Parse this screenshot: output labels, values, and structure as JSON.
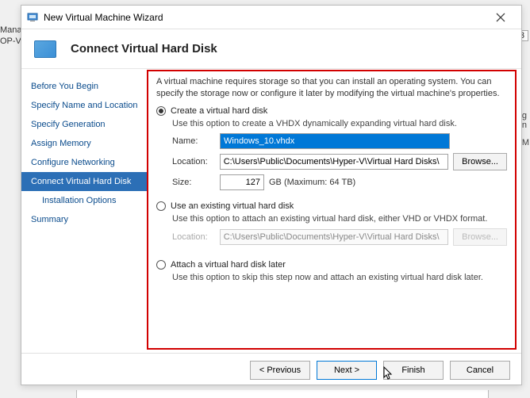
{
  "background": {
    "text1": "Manag",
    "text2": "OP-V",
    "text3": "3",
    "rlabel1": "g",
    "rlabel2": "n",
    "rlabel3": "M"
  },
  "titlebar": {
    "title": "New Virtual Machine Wizard"
  },
  "header": {
    "title": "Connect Virtual Hard Disk"
  },
  "sidebar": {
    "items": [
      {
        "label": "Before You Begin"
      },
      {
        "label": "Specify Name and Location"
      },
      {
        "label": "Specify Generation"
      },
      {
        "label": "Assign Memory"
      },
      {
        "label": "Configure Networking"
      },
      {
        "label": "Connect Virtual Hard Disk"
      },
      {
        "label": "Installation Options"
      },
      {
        "label": "Summary"
      }
    ]
  },
  "content": {
    "intro": "A virtual machine requires storage so that you can install an operating system. You can specify the storage now or configure it later by modifying the virtual machine's properties.",
    "opt1": {
      "label": "Create a virtual hard disk",
      "desc": "Use this option to create a VHDX dynamically expanding virtual hard disk.",
      "name_label": "Name:",
      "name_value": "Windows_10.vhdx",
      "loc_label": "Location:",
      "loc_value": "C:\\Users\\Public\\Documents\\Hyper-V\\Virtual Hard Disks\\",
      "browse": "Browse...",
      "size_label": "Size:",
      "size_value": "127",
      "size_unit": "GB (Maximum: 64 TB)"
    },
    "opt2": {
      "label": "Use an existing virtual hard disk",
      "desc": "Use this option to attach an existing virtual hard disk, either VHD or VHDX format.",
      "loc_label": "Location:",
      "loc_value": "C:\\Users\\Public\\Documents\\Hyper-V\\Virtual Hard Disks\\",
      "browse": "Browse..."
    },
    "opt3": {
      "label": "Attach a virtual hard disk later",
      "desc": "Use this option to skip this step now and attach an existing virtual hard disk later."
    }
  },
  "footer": {
    "previous": "< Previous",
    "next": "Next >",
    "finish": "Finish",
    "cancel": "Cancel"
  }
}
